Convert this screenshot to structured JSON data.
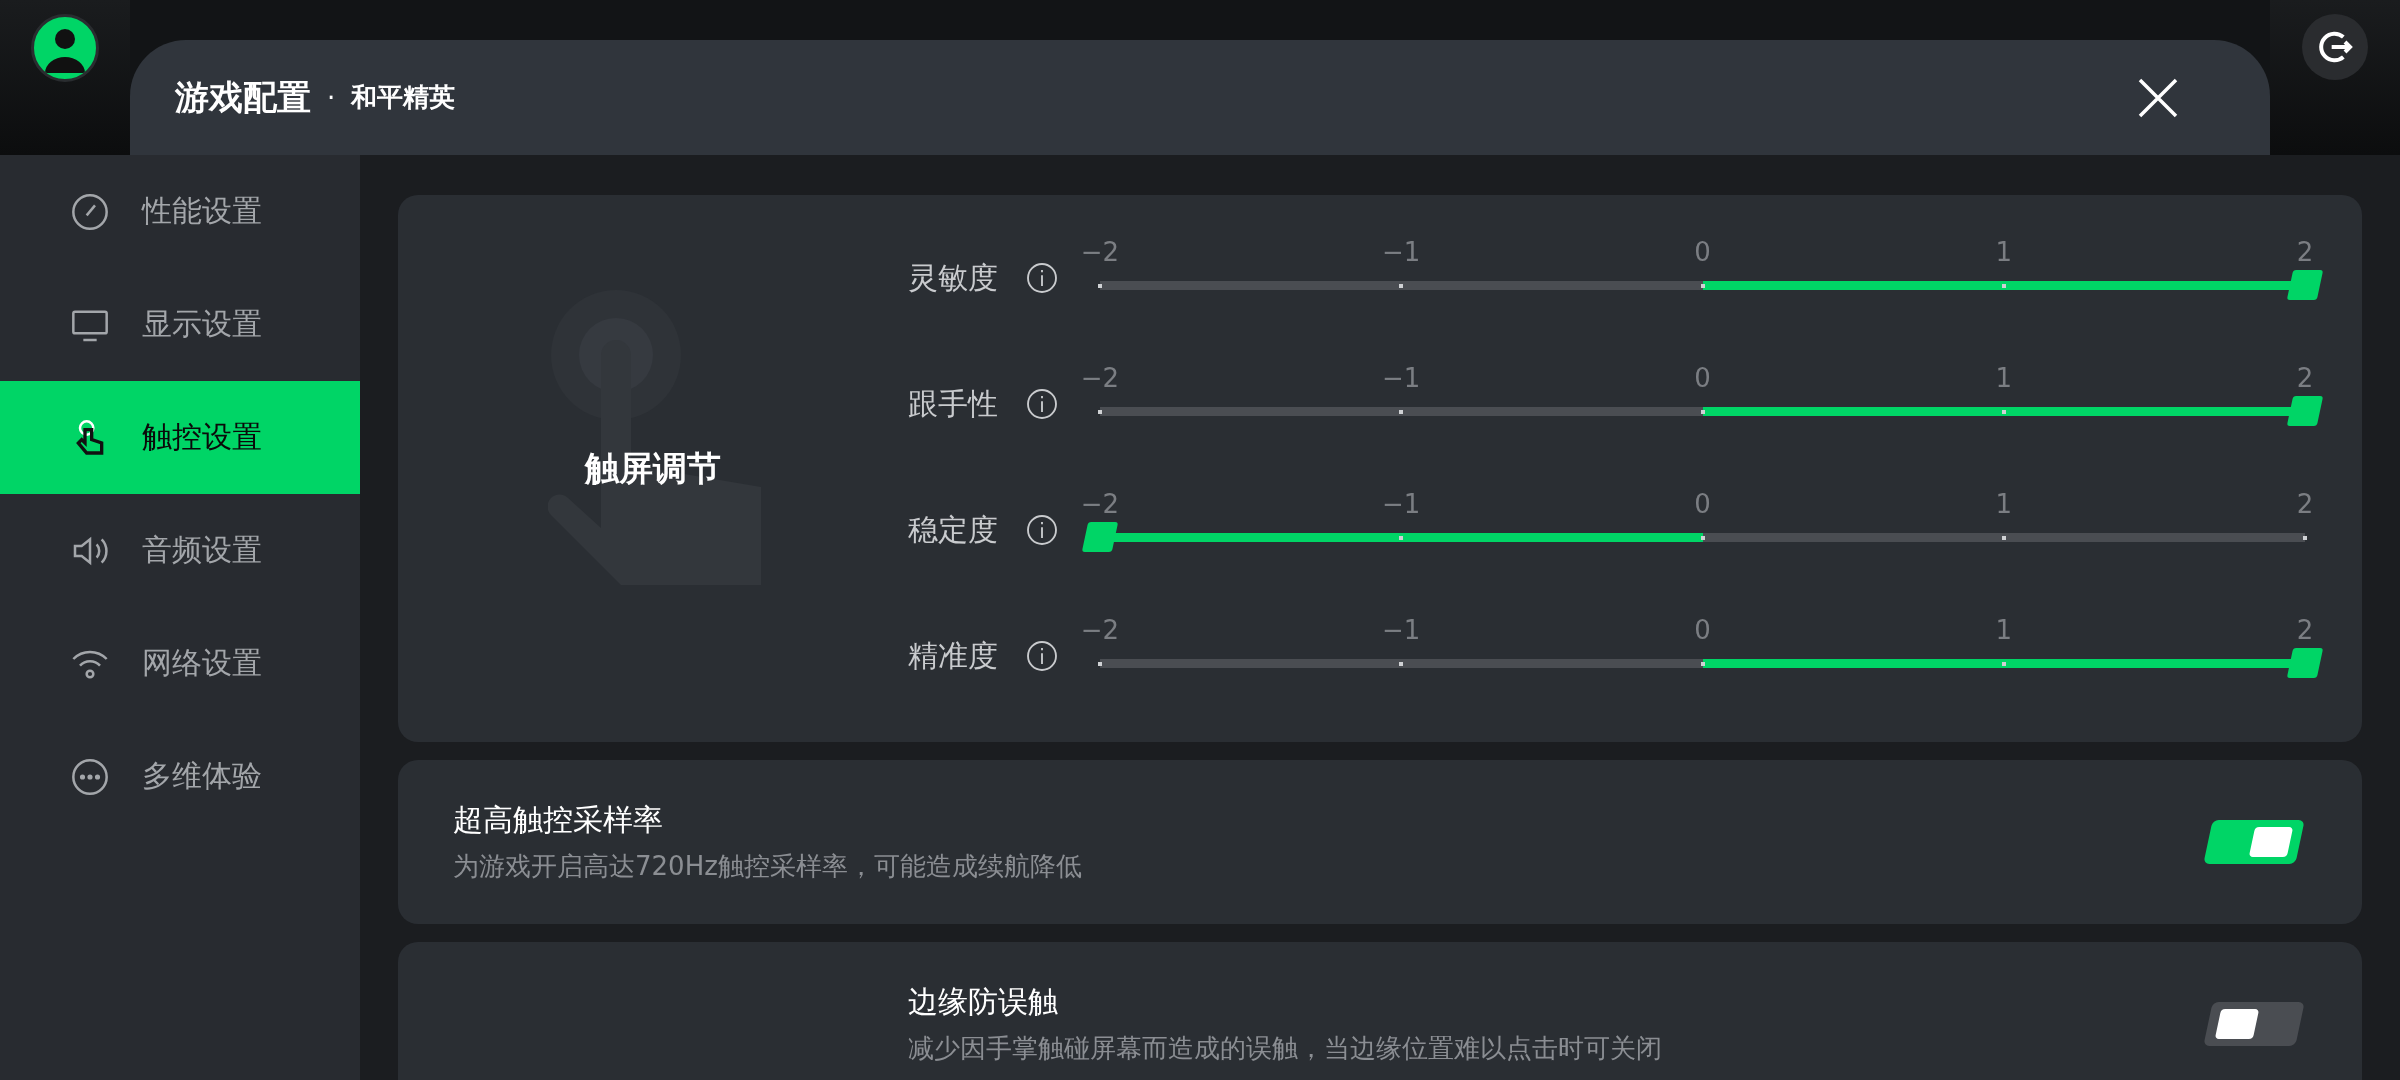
{
  "header": {
    "title": "游戏配置",
    "separator": "·",
    "subtitle": "和平精英"
  },
  "sidebar": {
    "items": [
      {
        "label": "性能设置",
        "kind": "gauge",
        "selected": false
      },
      {
        "label": "显示设置",
        "kind": "monitor",
        "selected": false
      },
      {
        "label": "触控设置",
        "kind": "touch",
        "selected": true
      },
      {
        "label": "音频设置",
        "kind": "speaker",
        "selected": false
      },
      {
        "label": "网络设置",
        "kind": "wifi",
        "selected": false
      },
      {
        "label": "多维体验",
        "kind": "more",
        "selected": false
      }
    ]
  },
  "touch_card": {
    "title": "触屏调节",
    "sliders": [
      {
        "label": "灵敏度",
        "level": 1,
        "ticks": [
          "−2",
          "−1",
          "0",
          "1",
          "2"
        ]
      },
      {
        "label": "跟手性",
        "level": 1,
        "ticks": [
          "−2",
          "−1",
          "0",
          "1",
          "2"
        ]
      },
      {
        "label": "稳定度",
        "level": 0,
        "ticks": [
          "−2",
          "−1",
          "0",
          "1",
          "2"
        ]
      },
      {
        "label": "精准度",
        "level": 1,
        "ticks": [
          "−2",
          "−1",
          "0",
          "1",
          "2"
        ]
      }
    ]
  },
  "toggles": [
    {
      "kind": "plain",
      "title": "超高触控采样率",
      "description": "为游戏开启高达720Hz触控采样率，可能造成续航降低",
      "on": true
    },
    {
      "kind": "indented",
      "title": "边缘防误触",
      "description": "减少因手掌触碰屏幕而造成的误触，当边缘位置难以点击时可关闭",
      "on": false
    }
  ]
}
